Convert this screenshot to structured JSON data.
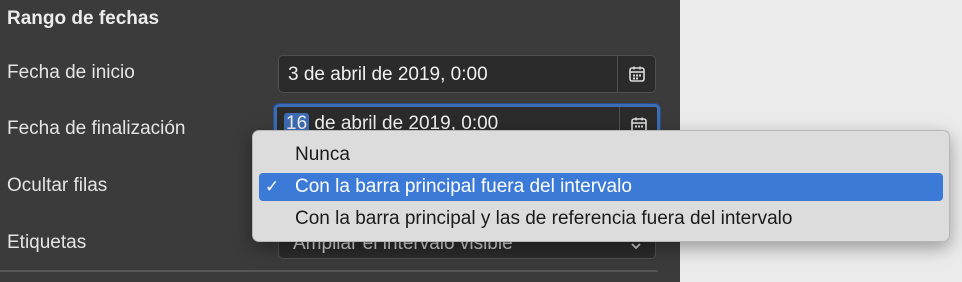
{
  "section": {
    "title": "Rango de fechas"
  },
  "start_date": {
    "label": "Fecha de inicio",
    "value": "3 de abril de 2019, 0:00"
  },
  "end_date": {
    "label": "Fecha de finalización",
    "day": "16",
    "rest": " de abril de 2019, 0:00"
  },
  "hide_rows": {
    "label": "Ocultar filas",
    "options": [
      {
        "label": "Nunca",
        "checked": false
      },
      {
        "label": "Con la barra principal fuera del intervalo",
        "checked": true
      },
      {
        "label": "Con la barra principal y las de referencia fuera del intervalo",
        "checked": false
      }
    ],
    "check_glyph": "✓"
  },
  "labels": {
    "label": "Etiquetas",
    "value": "Ampliar el intervalo visible"
  },
  "colors": {
    "accent": "#3c7ad8",
    "panel": "#3b3b3b",
    "menu": "#dcdcdc"
  },
  "icons": {
    "calendar": "calendar-icon",
    "chevron": "chevron-down-icon"
  }
}
